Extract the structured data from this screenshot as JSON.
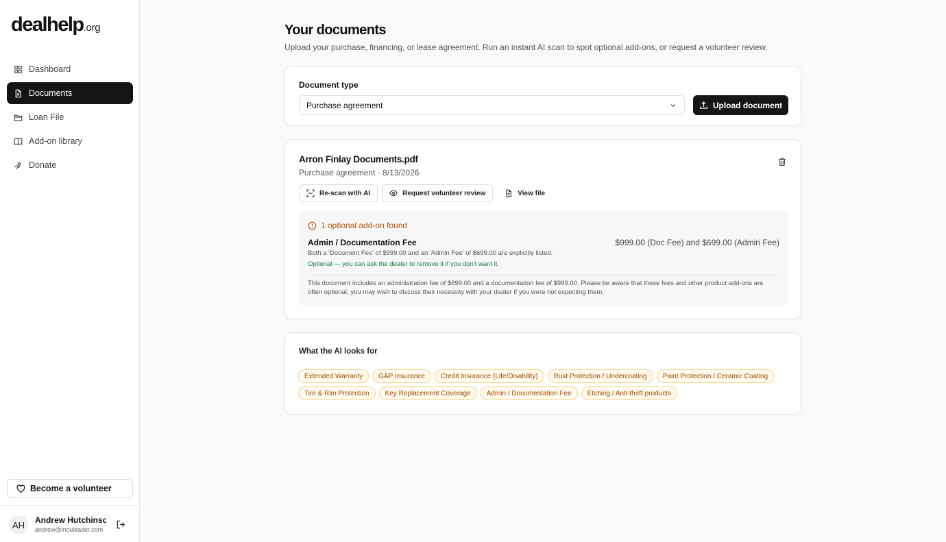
{
  "brand": {
    "main": "dealhelp",
    "tld": ".org"
  },
  "sidebar": {
    "items": [
      {
        "label": "Dashboard",
        "icon": "grid-icon",
        "active": false
      },
      {
        "label": "Documents",
        "icon": "document-icon",
        "active": true
      },
      {
        "label": "Loan File",
        "icon": "folder-icon",
        "active": false
      },
      {
        "label": "Add-on library",
        "icon": "book-icon",
        "active": false
      },
      {
        "label": "Donate",
        "icon": "hand-heart-icon",
        "active": false
      }
    ],
    "volunteer_label": "Become a volunteer",
    "user": {
      "initials": "AH",
      "name": "Andrew Hutchinson",
      "email": "andrew@inculeader.com"
    }
  },
  "main": {
    "title": "Your documents",
    "subtitle": "Upload your purchase, financing, or lease agreement. Run an instant AI scan to spot optional add-ons, or request a volunteer review.",
    "upload_card": {
      "label": "Document type",
      "selected": "Purchase agreement",
      "upload_label": "Upload document"
    },
    "document": {
      "file_name": "Arron Finlay Documents.pdf",
      "meta": "Purchase agreement · 8/13/2026",
      "actions": {
        "rescan": "Re-scan with AI",
        "review": "Request volunteer review",
        "view": "View file"
      },
      "findings": {
        "heading": "1 optional add-on found",
        "addon_title": "Admin / Documentation Fee",
        "addon_amount": "$999.00 (Doc Fee) and $699.00 (Admin Fee)",
        "addon_detail": "Both a 'Document Fee' of $999.00 and an 'Admin Fee' of $699.00 are explicitly listed.",
        "addon_note": "Optional — you can ask the dealer to remove it if you don't want it.",
        "summary": "This document includes an administration fee of $699.00 and a documentation fee of $999.00. Please be aware that these fees and other product add-ons are often optional; you may wish to discuss their necessity with your dealer if you were not expecting them."
      }
    },
    "looks_for": {
      "title": "What the AI looks for",
      "tags": [
        "Extended Warranty",
        "GAP Insurance",
        "Credit Insurance (Life/Disability)",
        "Rust Protection / Undercoating",
        "Paint Protection / Ceramic Coating",
        "Tire & Rim Protection",
        "Key Replacement Coverage",
        "Admin / Documentation Fee",
        "Etching / Anti-theft products"
      ]
    }
  },
  "colors": {
    "accent": "#141414",
    "warning": "#b45309",
    "success": "#15803d",
    "tag_bg": "#fffaeb",
    "tag_border": "#f4d58d"
  }
}
